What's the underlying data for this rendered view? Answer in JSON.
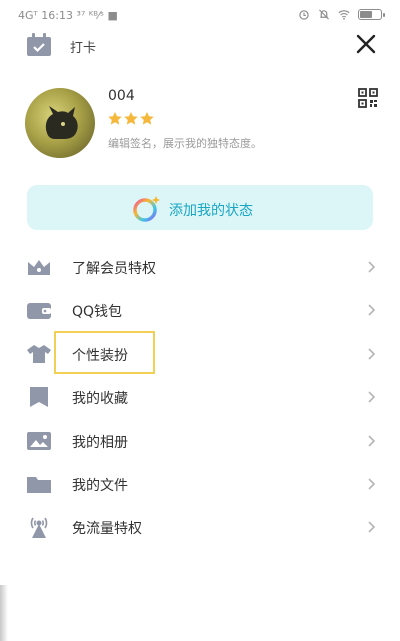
{
  "status_bar": {
    "left_text": "4Gᵀ 16:13 ³⁷ ᴷᴮ⁄ˢ ■"
  },
  "header": {
    "title": "打卡",
    "checkin_icon": "calendar-check-icon",
    "close_icon": "close-icon"
  },
  "profile": {
    "username": "004",
    "stars": 3,
    "signature": "编辑签名，展示我的独特态度。",
    "qr_icon": "qr-code-icon"
  },
  "banner": {
    "label": "添加我的状态",
    "icon": "colorful-ring-icon"
  },
  "menu": {
    "items": [
      {
        "label": "了解会员特权",
        "icon": "crown-icon"
      },
      {
        "label": "QQ钱包",
        "icon": "wallet-icon"
      },
      {
        "label": "个性装扮",
        "icon": "tshirt-icon"
      },
      {
        "label": "我的收藏",
        "icon": "bookmark-icon"
      },
      {
        "label": "我的相册",
        "icon": "photo-icon"
      },
      {
        "label": "我的文件",
        "icon": "folder-icon"
      },
      {
        "label": "免流量特权",
        "icon": "signal-tower-icon"
      }
    ]
  },
  "colors": {
    "icon": "#9097a9",
    "accent": "#1aa5c2",
    "banner_bg": "#dcf6f8",
    "highlight": "#f2cf55",
    "star": "#f5b83d"
  }
}
